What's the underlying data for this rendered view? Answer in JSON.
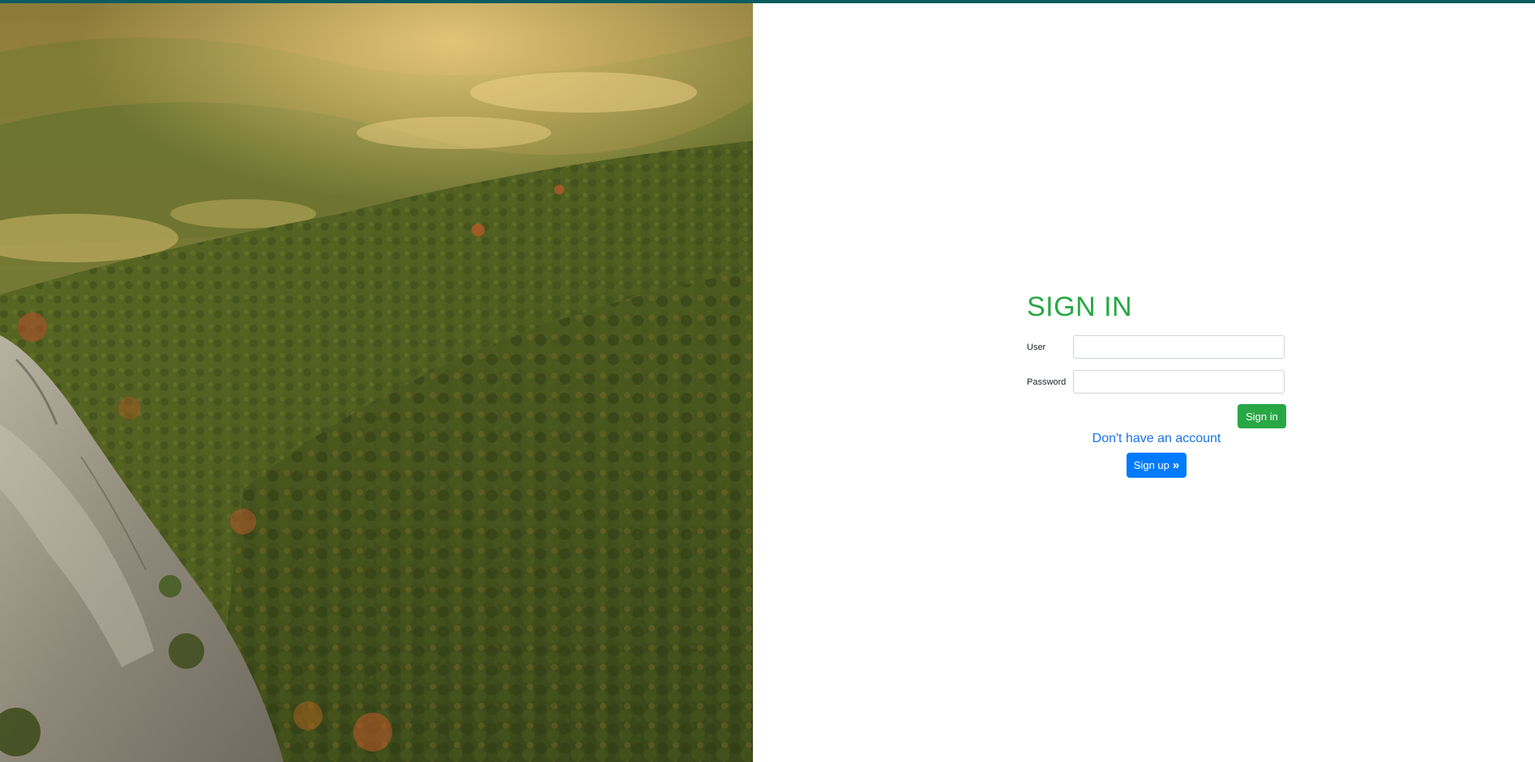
{
  "form": {
    "title": "SIGN IN",
    "user_label": "User",
    "user_value": "",
    "password_label": "Password",
    "password_value": "",
    "signin_label": "Sign in",
    "no_account_text": "Don't have an account",
    "signup_label": "Sign up",
    "signup_icon": "double-chevron-right-icon"
  },
  "colors": {
    "top_bar": "#0a5c5f",
    "title": "#28a745",
    "signin_button": "#28a745",
    "signup_button": "#007bff",
    "link_text": "#1a73e8"
  },
  "image": {
    "subject": "forest-mountain-landscape"
  }
}
